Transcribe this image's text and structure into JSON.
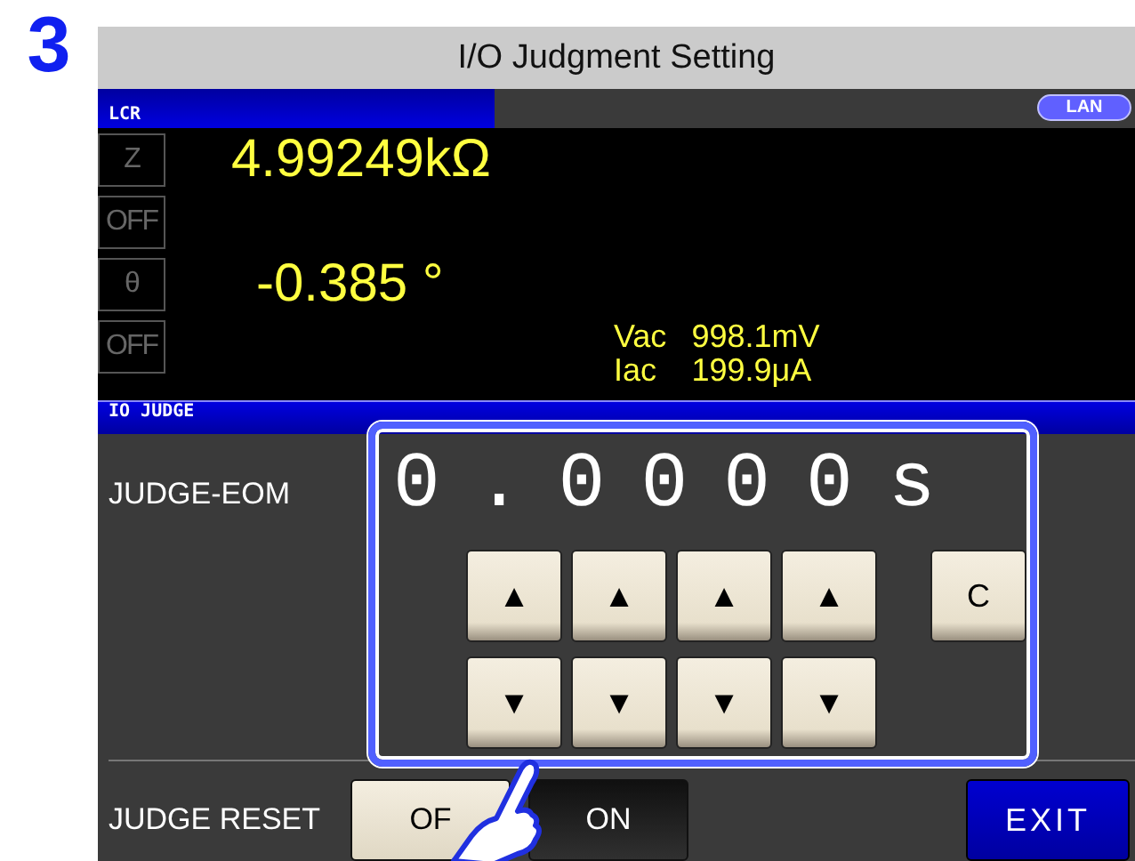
{
  "step": "3",
  "title": "I/O Judgment Setting",
  "top_bar": {
    "mode": "LCR",
    "badge": "LAN"
  },
  "rows": [
    {
      "param": "Z",
      "value": "4.99249kΩ"
    },
    {
      "param": "OFF"
    },
    {
      "param": "θ",
      "value": "-0.385 °"
    },
    {
      "param": "OFF"
    }
  ],
  "monitor": [
    {
      "name": "Vac",
      "value": "998.1mV"
    },
    {
      "name": "Iac",
      "value": "199.9μA"
    }
  ],
  "panel": {
    "header": "IO JUDGE",
    "eom_label": "JUDGE-EOM",
    "display": "0.0000s",
    "up_buttons": [
      "▲",
      "▲",
      "▲",
      "▲"
    ],
    "down_buttons": [
      "▼",
      "▼",
      "▼",
      "▼"
    ],
    "clear_button": "C",
    "reset_label": "JUDGE RESET",
    "reset_options": [
      {
        "label": "OF",
        "selected": true
      },
      {
        "label": "ON",
        "selected": false
      }
    ],
    "exit": "EXIT"
  }
}
